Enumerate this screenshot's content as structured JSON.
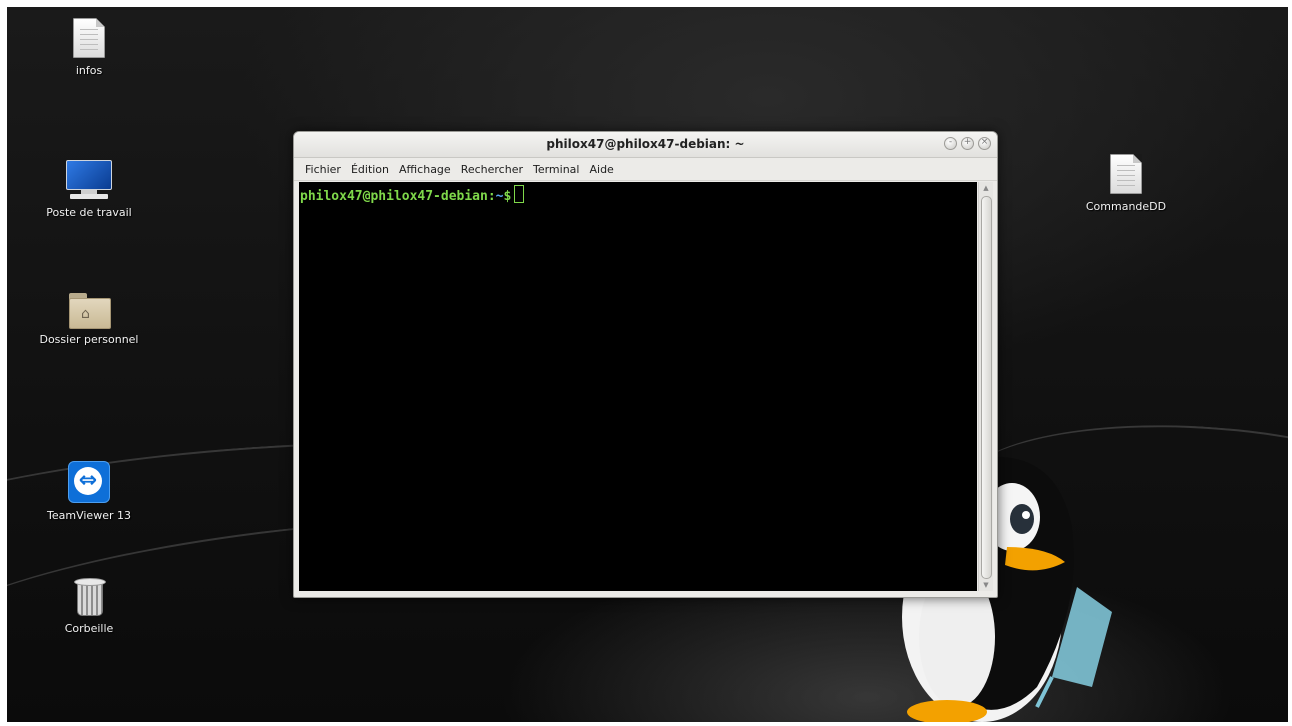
{
  "desktop": {
    "icons": [
      {
        "label": "infos",
        "icon": "document-icon"
      },
      {
        "label": "Poste de travail",
        "icon": "computer-icon"
      },
      {
        "label": "Dossier personnel",
        "icon": "home-folder-icon"
      },
      {
        "label": "TeamViewer 13",
        "icon": "teamviewer-icon"
      },
      {
        "label": "Corbeille",
        "icon": "trash-icon"
      },
      {
        "label": "CommandeDD",
        "icon": "document-icon"
      }
    ]
  },
  "terminal": {
    "title": "philox47@philox47-debian: ~",
    "window_buttons": [
      "minimize",
      "maximize",
      "close"
    ],
    "menu": [
      "Fichier",
      "Édition",
      "Affichage",
      "Rechercher",
      "Terminal",
      "Aide"
    ],
    "prompt": {
      "user_host": "philox47@philox47-debian",
      "separator": ":",
      "path": "~",
      "symbol": "$"
    },
    "colors": {
      "prompt_user": "#7fd84a",
      "prompt_path": "#5aa6f0",
      "background": "#000000"
    }
  }
}
